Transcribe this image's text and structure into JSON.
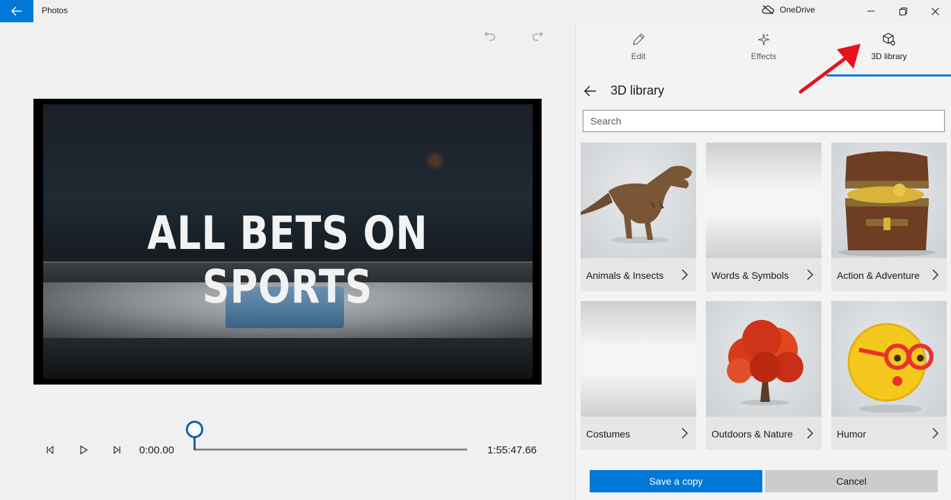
{
  "window": {
    "title": "Photos",
    "onedrive_label": "OneDrive"
  },
  "video": {
    "overlay_text": "ALL BETS ON SPORTS",
    "current_time": "0:00.00",
    "total_time": "1:55:47.66",
    "playhead_progress": 0
  },
  "tabs": [
    {
      "label": "Edit",
      "icon": "pencil-icon"
    },
    {
      "label": "Effects",
      "icon": "sparkle-icon"
    },
    {
      "label": "3D library",
      "icon": "3d-box-icon",
      "selected": true
    }
  ],
  "library": {
    "title": "3D library",
    "search_placeholder": "Search",
    "categories": [
      {
        "label": "Animals & Insects",
        "thumb": "t-rex"
      },
      {
        "label": "Words & Symbols",
        "thumb": "blank"
      },
      {
        "label": "Action & Adventure",
        "thumb": "treasure-chest"
      },
      {
        "label": "Costumes",
        "thumb": "blank"
      },
      {
        "label": "Outdoors & Nature",
        "thumb": "red-tree"
      },
      {
        "label": "Humor",
        "thumb": "emoji-glasses"
      }
    ]
  },
  "actions": {
    "save_label": "Save a copy",
    "cancel_label": "Cancel"
  },
  "colors": {
    "accent": "#0078d7",
    "annotation_arrow": "#e8121c"
  }
}
